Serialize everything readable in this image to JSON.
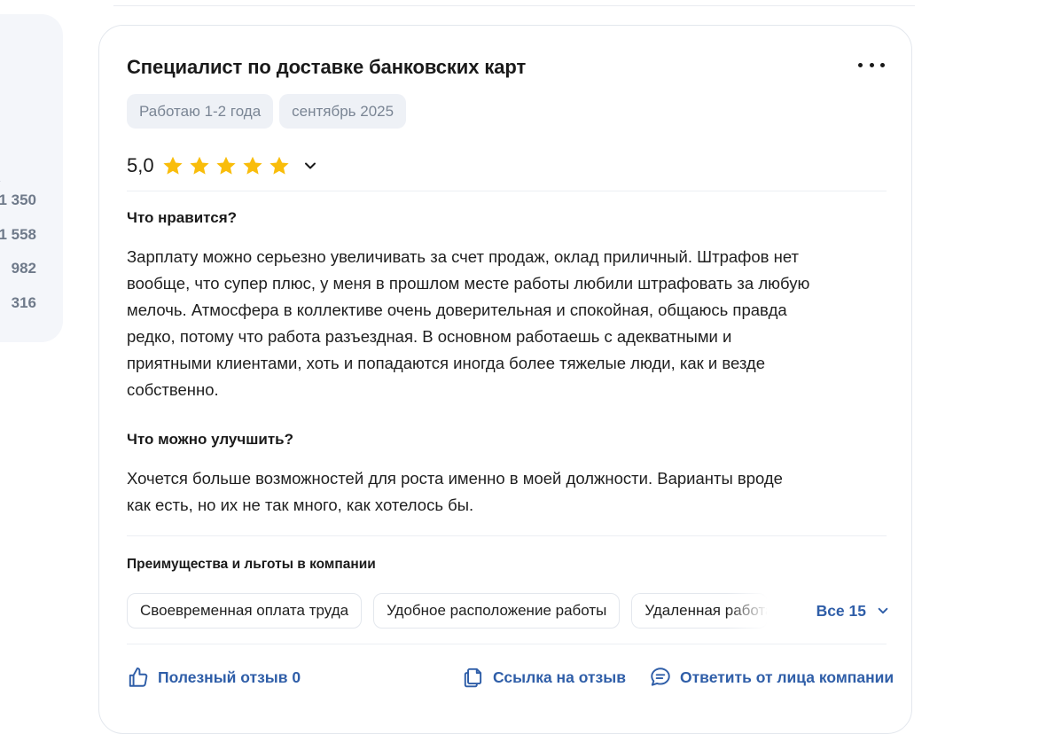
{
  "side_stats": [
    "1 350",
    "1 558",
    "982",
    "316"
  ],
  "review": {
    "position_title": "Специалист по доставке банковских карт",
    "tags": [
      "Работаю 1-2 года",
      "сентябрь 2025"
    ],
    "rating": "5,0",
    "stars": 5,
    "likes_heading": "Что нравится?",
    "likes_lines": [
      "Зарплату можно серьезно увеличивать за счет продаж, оклад приличный. Штрафов нет",
      "вообще, что супер плюс, у меня в прошлом месте работы любили штрафовать за любую",
      "мелочь. Атмосфера в коллективе очень доверительная и спокойная, общаюсь правда",
      "редко, потому что работа разъездная. В основном работаешь с адекватными и",
      "приятными клиентами, хоть и попадаются иногда более тяжелые люди, как и везде",
      "собственно."
    ],
    "improve_heading": "Что можно улучшить?",
    "improve_lines": [
      "Хочется больше возможностей для роста именно в моей должности. Варианты вроде",
      "как есть, но их не так много, как хотелось бы."
    ],
    "benefits_heading": "Преимущества и льготы в компании",
    "benefits": [
      "Своевременная оплата труда",
      "Удобное расположение работы",
      "Удаленная работа"
    ],
    "benefits_all": "Все 15",
    "useful_label": "Полезный отзыв 0",
    "link_label": "Ссылка на отзыв",
    "reply_label": "Ответить от лица компании"
  },
  "colors": {
    "accent": "#2f5ea8",
    "star": "#f9bd0b",
    "tag_bg": "#eef1f6"
  }
}
